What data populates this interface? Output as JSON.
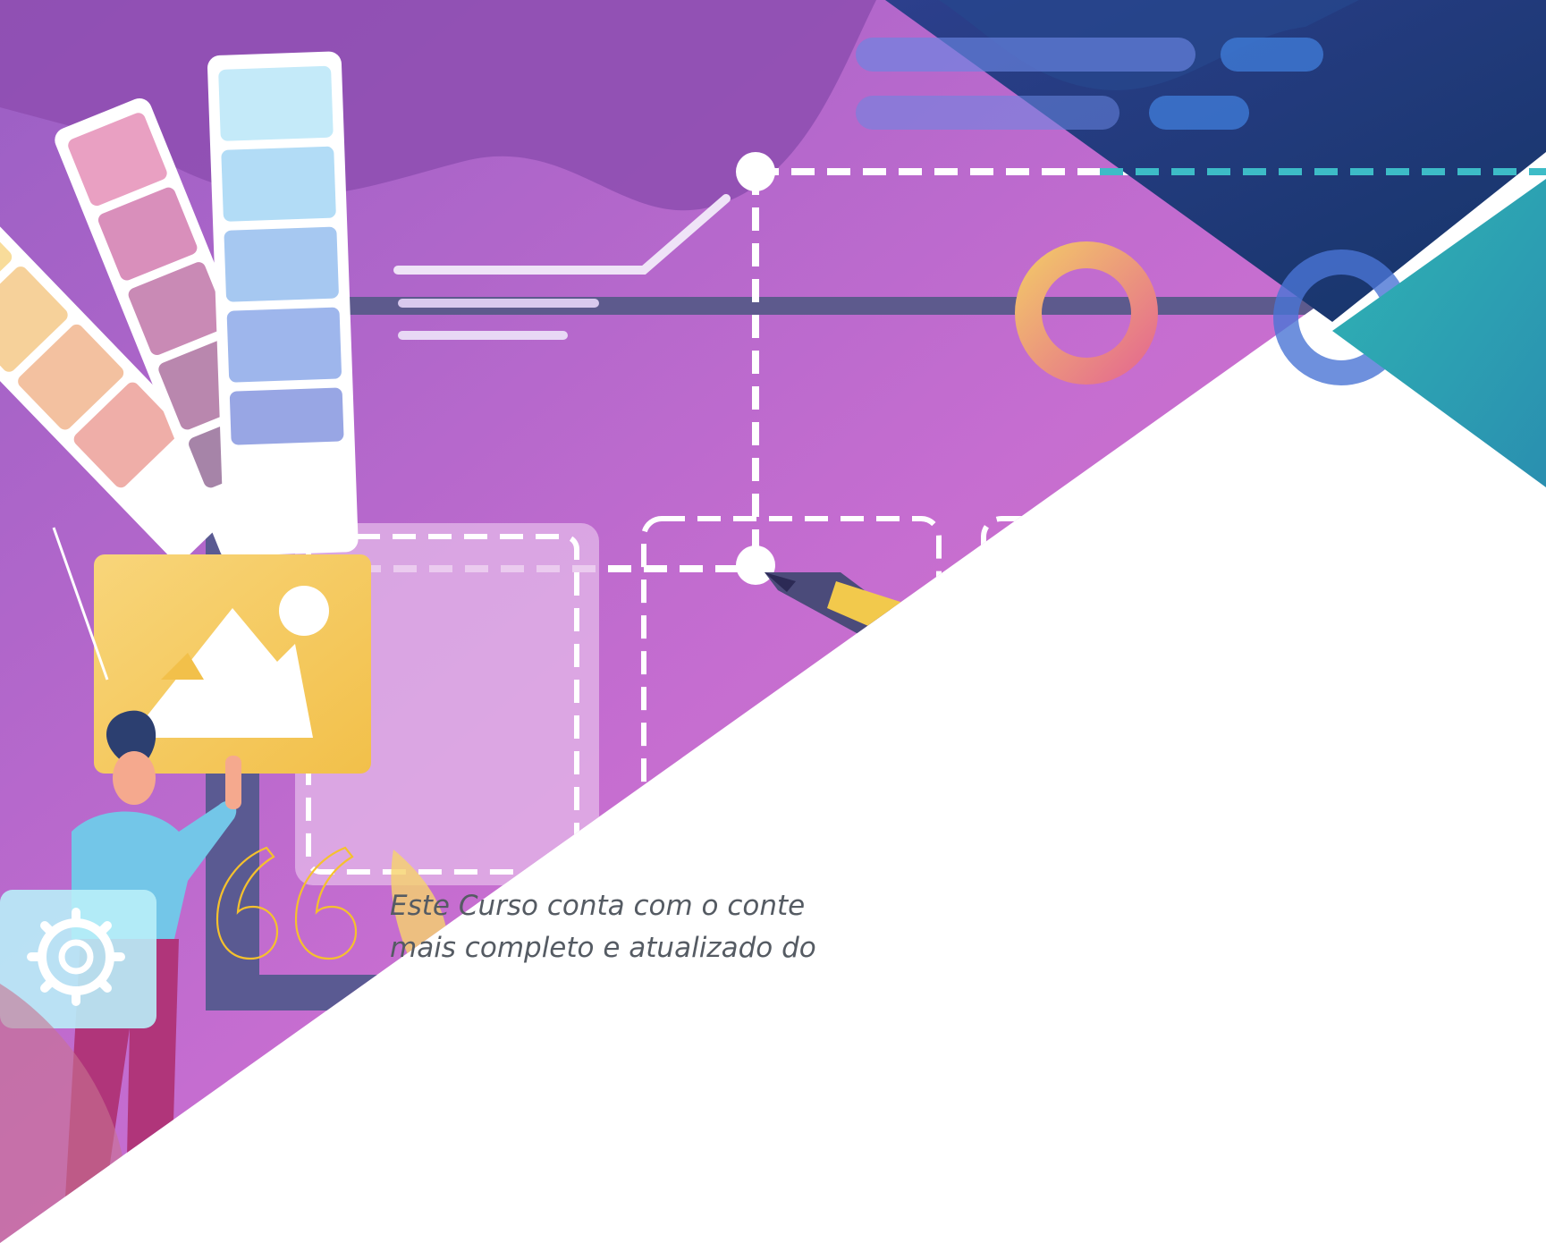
{
  "quote": {
    "line1": "Este Curso conta com o conte",
    "line2": "mais completo e atualizado do"
  },
  "colors": {
    "purple_bg": "#a467c9",
    "magenta_bg": "#d56fc6",
    "navy_corner": "#1b3a7a",
    "teal_corner": "#2a9eb0",
    "quote_mark": "#f5c12d",
    "quote_text": "#555b63"
  },
  "icons": [
    "color-swatch-fan-icon",
    "image-picture-icon",
    "gear-icon",
    "pencil-icon",
    "donut-chart-icon"
  ]
}
